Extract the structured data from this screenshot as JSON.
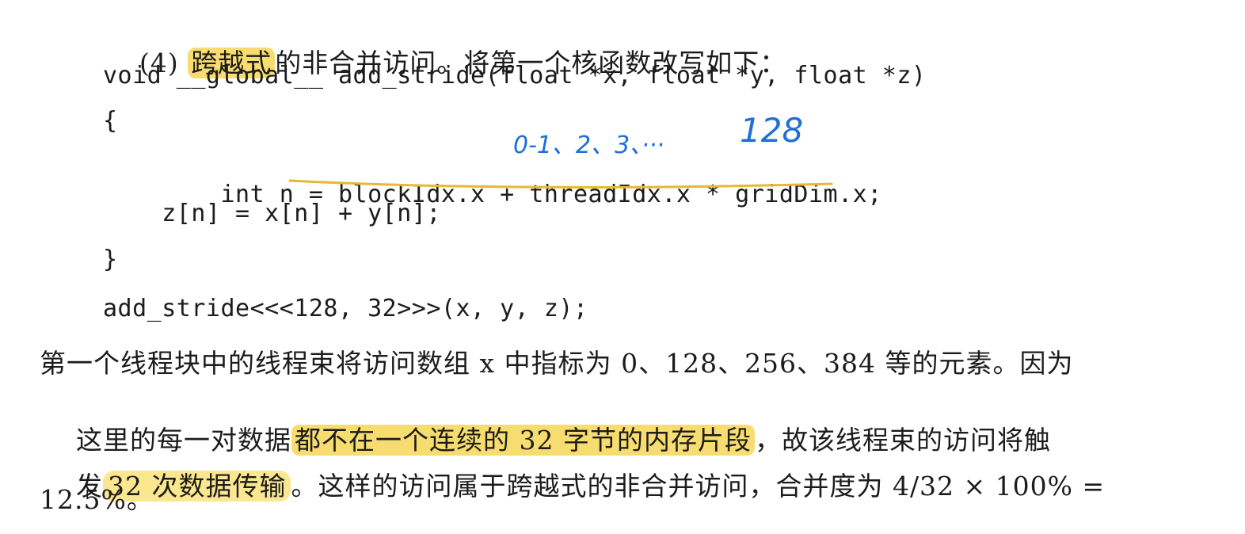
{
  "heading": {
    "num": "(4) ",
    "highlighted": "跨越式",
    "rest": "的非合并访问。将第一个核函数改写如下："
  },
  "code": {
    "line1": "void __global__ add_stride(float *x, float *y, float *z)",
    "line2": "{",
    "line3_prefix": "    int n = ",
    "line3_expr": "blockIdx.x + threadIdx.x * gridDim",
    "line3_suffix": ".x;",
    "line4": "    z[n] = x[n] + y[n];",
    "line5": "}",
    "line6": "add_stride<<<128, 32>>>(x, y, z);"
  },
  "annotations": {
    "thread_indices": "0-1、2、3、···",
    "grid_dim": "128",
    "underline_color": "#e8b830"
  },
  "paragraph": {
    "line1": "第一个线程块中的线程束将访问数组 x 中指标为 0、128、256、384 等的元素。因为",
    "line2_a": "这里的每一对数据",
    "line2_hl": "都不在一个连续的 32 字节的内存片段",
    "line2_b": "，故该线程束的访问将触",
    "line3_a": "发",
    "line3_hl": "32 次数据传输",
    "line3_b": "。这样的访问属于跨越式的非合并访问，合并度为 4/32 × 100% =",
    "line4": "12.5%。"
  },
  "colors": {
    "highlight": "#f7dc6f",
    "ink": "#1c1c1c",
    "pen_blue": "#1e6fd9"
  }
}
